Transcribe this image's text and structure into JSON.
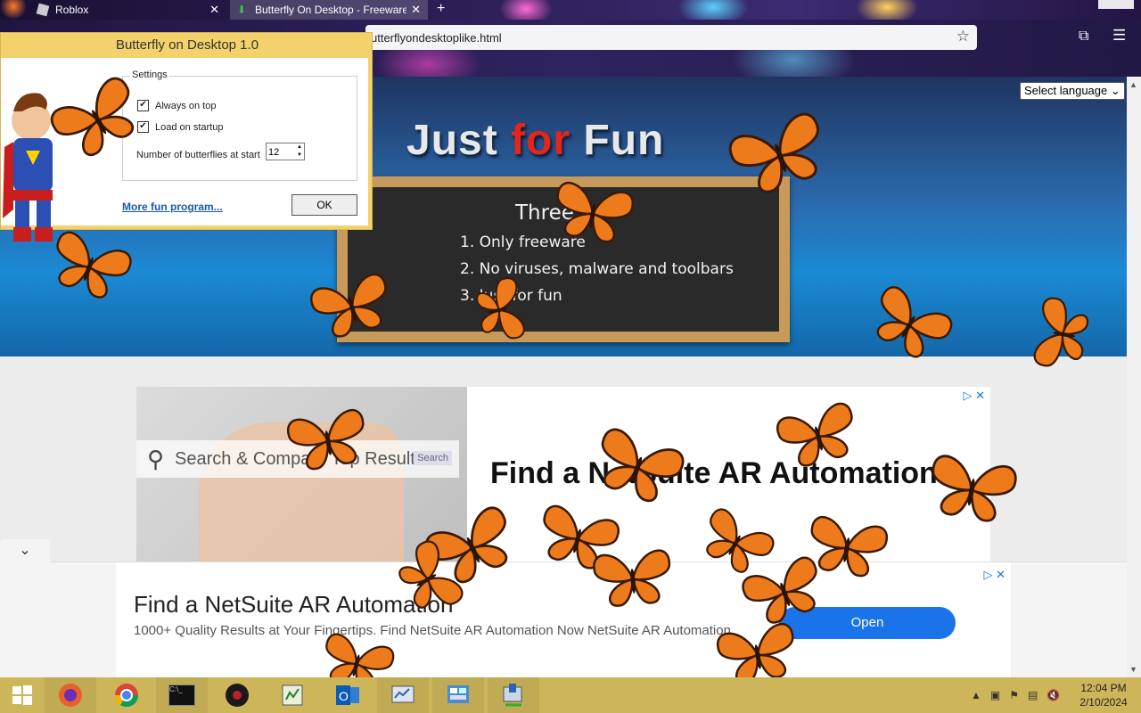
{
  "browser": {
    "tabs": [
      {
        "title": "Roblox"
      },
      {
        "title": "Butterfly On Desktop - Freeware"
      }
    ],
    "url": "utterflyondesktoplike.html"
  },
  "page": {
    "hero_title_part1": "Just",
    "hero_title_part2": "for",
    "hero_title_part3": "Fun",
    "language_select": "Select language",
    "board": {
      "title": "Three ru",
      "rules": [
        "1. Only freeware",
        "2. No viruses, malware and toolbars",
        "3. Just for fun"
      ]
    },
    "ad_image_search": "Search & Compare Top Results",
    "ad_image_search_button": "Search",
    "ad_heading": "Find a NetSuite AR Automation"
  },
  "bottom_ad": {
    "title": "Find a NetSuite AR Automation",
    "description": "1000+ Quality Results at Your Fingertips. Find NetSuite AR Automation Now NetSuite AR Automation",
    "button": "Open"
  },
  "app": {
    "title": "Butterfly on Desktop 1.0",
    "settings_label": "Settings",
    "always_on_top": "Always on top",
    "load_on_startup": "Load on startup",
    "number_label": "Number of butterflies at start",
    "number_value": "12",
    "more_link": "More fun program...",
    "ok_button": "OK"
  },
  "taskbar": {
    "time": "12:04 PM",
    "date": "2/10/2024"
  }
}
